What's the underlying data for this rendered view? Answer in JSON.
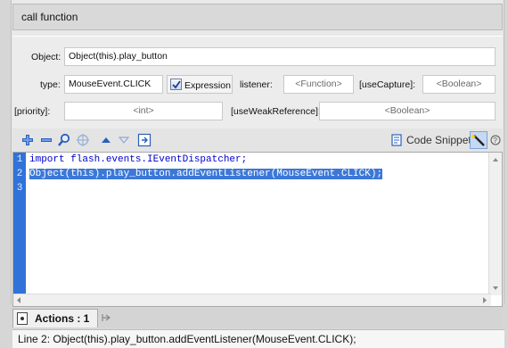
{
  "panel": {
    "title": "call function"
  },
  "params": {
    "object_label": "Object:",
    "object_value": "Object(this).play_button",
    "type_label": "type:",
    "type_value": "MouseEvent.CLICK",
    "expression_label": "Expression",
    "expression_checked": true,
    "listener_label": "listener:",
    "listener_placeholder": "<Function>",
    "usecapture_label": "[useCapture]:",
    "usecapture_placeholder": "<Boolean>",
    "priority_label": "[priority]:",
    "priority_placeholder": "<int>",
    "useweak_label": "[useWeakReference]:",
    "useweak_placeholder": "<Boolean>"
  },
  "toolbar": {
    "icons": [
      "add-icon",
      "remove-icon",
      "find-icon",
      "target-icon",
      "move-up-icon",
      "move-down-icon",
      "insert-icon",
      "code-snippets-icon",
      "wand-icon",
      "help-icon"
    ],
    "code_snippets_label": "Code Snippets"
  },
  "editor": {
    "lines": [
      {
        "num": "1",
        "text": "import flash.events.IEventDispatcher;"
      },
      {
        "num": "2",
        "text": "Object(this).play_button.addEventListener(MouseEvent.CLICK);"
      },
      {
        "num": "3",
        "text": ""
      }
    ]
  },
  "tabs": {
    "active_label": "Actions : 1"
  },
  "status": {
    "text": "Line 2: Object(this).play_button.addEventListener(MouseEvent.CLICK);"
  },
  "colors": {
    "gutter": "#2f73d9",
    "selection": "#3c78d8",
    "keyword": "#0000cc"
  }
}
